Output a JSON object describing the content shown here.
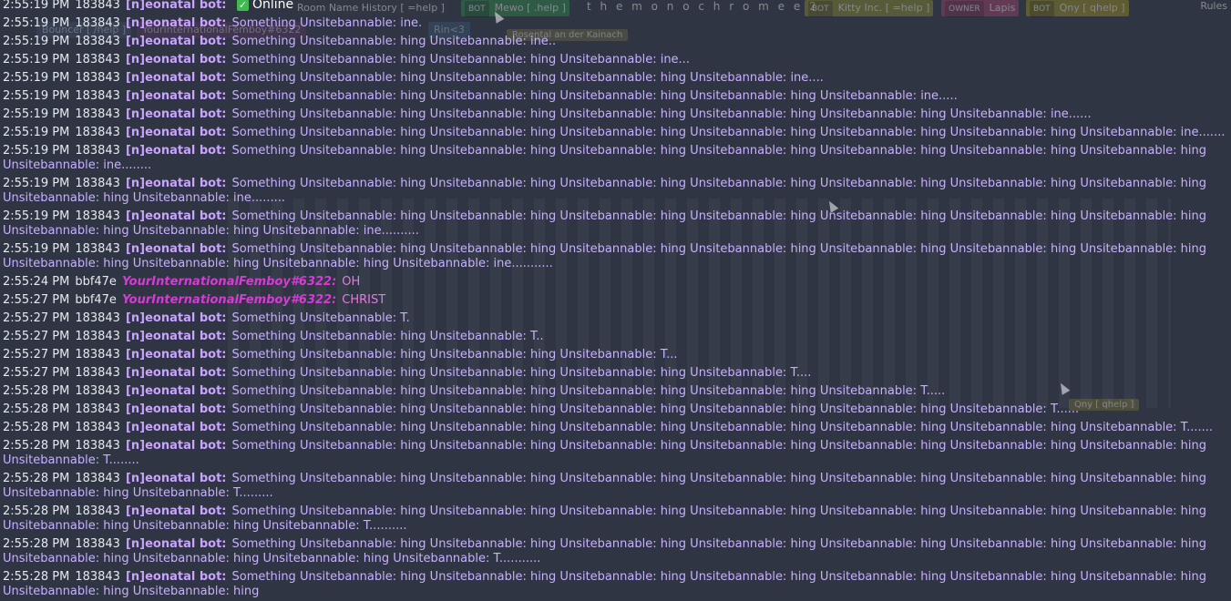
{
  "status": {
    "online_label": "Online"
  },
  "room": {
    "title": "t h e m o n o c h r o m e",
    "title_suffix": "e 2",
    "history_tag": "Room Name History [ =help ]",
    "rules": "Rules"
  },
  "top_badges": [
    {
      "role": "BOT",
      "name": "Kitty Inc. [ =help ]"
    },
    {
      "role": "OWNER",
      "name": "Lapis"
    },
    {
      "role": "BOT",
      "name": "Qny [ qhelp ]"
    },
    {
      "role": "BOT",
      "name": "Mewo [ .help ]"
    }
  ],
  "second_row_tags": [
    {
      "name": "Bouncer [ /help ]"
    },
    {
      "name": "YourInternationalFemboy#6322"
    },
    {
      "name": "Rin<3"
    },
    {
      "name": "Rosental an der Kainach"
    }
  ],
  "floating_tags": [
    {
      "name": "Qny [ qhelp ]"
    }
  ],
  "messages": [
    {
      "kind": "bot",
      "time": "2:55:19 PM",
      "uid": "183843",
      "author": "[n]eonatal bot:",
      "text": ""
    },
    {
      "kind": "bot",
      "time": "2:55:19 PM",
      "uid": "183843",
      "author": "[n]eonatal bot:",
      "text": "Something Unsitebannable: ine."
    },
    {
      "kind": "bot",
      "time": "2:55:19 PM",
      "uid": "183843",
      "author": "[n]eonatal bot:",
      "text": "Something Unsitebannable: hing Unsitebannable: ine.."
    },
    {
      "kind": "bot",
      "time": "2:55:19 PM",
      "uid": "183843",
      "author": "[n]eonatal bot:",
      "text": "Something Unsitebannable: hing Unsitebannable: hing Unsitebannable: ine..."
    },
    {
      "kind": "bot",
      "time": "2:55:19 PM",
      "uid": "183843",
      "author": "[n]eonatal bot:",
      "text": "Something Unsitebannable: hing Unsitebannable: hing Unsitebannable: hing Unsitebannable: ine...."
    },
    {
      "kind": "bot",
      "time": "2:55:19 PM",
      "uid": "183843",
      "author": "[n]eonatal bot:",
      "text": "Something Unsitebannable: hing Unsitebannable: hing Unsitebannable: hing Unsitebannable: hing Unsitebannable: ine....."
    },
    {
      "kind": "bot",
      "time": "2:55:19 PM",
      "uid": "183843",
      "author": "[n]eonatal bot:",
      "text": "Something Unsitebannable: hing Unsitebannable: hing Unsitebannable: hing Unsitebannable: hing Unsitebannable: hing Unsitebannable: ine......"
    },
    {
      "kind": "bot",
      "time": "2:55:19 PM",
      "uid": "183843",
      "author": "[n]eonatal bot:",
      "text": "Something Unsitebannable: hing Unsitebannable: hing Unsitebannable: hing Unsitebannable: hing Unsitebannable: hing Unsitebannable: hing Unsitebannable: ine......."
    },
    {
      "kind": "bot",
      "time": "2:55:19 PM",
      "uid": "183843",
      "author": "[n]eonatal bot:",
      "text": "Something Unsitebannable: hing Unsitebannable: hing Unsitebannable: hing Unsitebannable: hing Unsitebannable: hing Unsitebannable: hing Unsitebannable: hing Unsitebannable: ine........"
    },
    {
      "kind": "bot",
      "time": "2:55:19 PM",
      "uid": "183843",
      "author": "[n]eonatal bot:",
      "text": "Something Unsitebannable: hing Unsitebannable: hing Unsitebannable: hing Unsitebannable: hing Unsitebannable: hing Unsitebannable: hing Unsitebannable: hing Unsitebannable: hing Unsitebannable: ine........."
    },
    {
      "kind": "bot",
      "time": "2:55:19 PM",
      "uid": "183843",
      "author": "[n]eonatal bot:",
      "text": "Something Unsitebannable: hing Unsitebannable: hing Unsitebannable: hing Unsitebannable: hing Unsitebannable: hing Unsitebannable: hing Unsitebannable: hing Unsitebannable: hing Unsitebannable: hing Unsitebannable: ine.........."
    },
    {
      "kind": "bot",
      "time": "2:55:19 PM",
      "uid": "183843",
      "author": "[n]eonatal bot:",
      "text": "Something Unsitebannable: hing Unsitebannable: hing Unsitebannable: hing Unsitebannable: hing Unsitebannable: hing Unsitebannable: hing Unsitebannable: hing Unsitebannable: hing Unsitebannable: hing Unsitebannable: hing Unsitebannable: ine..........."
    },
    {
      "kind": "user",
      "time": "2:55:24 PM",
      "uid": "bbf47e",
      "author": "YourInternationalFemboy#6322:",
      "text": "OH"
    },
    {
      "kind": "user",
      "time": "2:55:27 PM",
      "uid": "bbf47e",
      "author": "YourInternationalFemboy#6322:",
      "text": "CHRIST"
    },
    {
      "kind": "bot",
      "time": "2:55:27 PM",
      "uid": "183843",
      "author": "[n]eonatal bot:",
      "text": "Something Unsitebannable: T."
    },
    {
      "kind": "bot",
      "time": "2:55:27 PM",
      "uid": "183843",
      "author": "[n]eonatal bot:",
      "text": "Something Unsitebannable: hing Unsitebannable: T.."
    },
    {
      "kind": "bot",
      "time": "2:55:27 PM",
      "uid": "183843",
      "author": "[n]eonatal bot:",
      "text": "Something Unsitebannable: hing Unsitebannable: hing Unsitebannable: T..."
    },
    {
      "kind": "bot",
      "time": "2:55:27 PM",
      "uid": "183843",
      "author": "[n]eonatal bot:",
      "text": "Something Unsitebannable: hing Unsitebannable: hing Unsitebannable: hing Unsitebannable: T...."
    },
    {
      "kind": "bot",
      "time": "2:55:28 PM",
      "uid": "183843",
      "author": "[n]eonatal bot:",
      "text": "Something Unsitebannable: hing Unsitebannable: hing Unsitebannable: hing Unsitebannable: hing Unsitebannable: T....."
    },
    {
      "kind": "bot",
      "time": "2:55:28 PM",
      "uid": "183843",
      "author": "[n]eonatal bot:",
      "text": "Something Unsitebannable: hing Unsitebannable: hing Unsitebannable: hing Unsitebannable: hing Unsitebannable: hing Unsitebannable: T......"
    },
    {
      "kind": "bot",
      "time": "2:55:28 PM",
      "uid": "183843",
      "author": "[n]eonatal bot:",
      "text": "Something Unsitebannable: hing Unsitebannable: hing Unsitebannable: hing Unsitebannable: hing Unsitebannable: hing Unsitebannable: hing Unsitebannable: T......."
    },
    {
      "kind": "bot",
      "time": "2:55:28 PM",
      "uid": "183843",
      "author": "[n]eonatal bot:",
      "text": "Something Unsitebannable: hing Unsitebannable: hing Unsitebannable: hing Unsitebannable: hing Unsitebannable: hing Unsitebannable: hing Unsitebannable: hing Unsitebannable: T........"
    },
    {
      "kind": "bot",
      "time": "2:55:28 PM",
      "uid": "183843",
      "author": "[n]eonatal bot:",
      "text": "Something Unsitebannable: hing Unsitebannable: hing Unsitebannable: hing Unsitebannable: hing Unsitebannable: hing Unsitebannable: hing Unsitebannable: hing Unsitebannable: hing Unsitebannable: T........."
    },
    {
      "kind": "bot",
      "time": "2:55:28 PM",
      "uid": "183843",
      "author": "[n]eonatal bot:",
      "text": "Something Unsitebannable: hing Unsitebannable: hing Unsitebannable: hing Unsitebannable: hing Unsitebannable: hing Unsitebannable: hing Unsitebannable: hing Unsitebannable: hing Unsitebannable: hing Unsitebannable: T.........."
    },
    {
      "kind": "bot",
      "time": "2:55:28 PM",
      "uid": "183843",
      "author": "[n]eonatal bot:",
      "text": "Something Unsitebannable: hing Unsitebannable: hing Unsitebannable: hing Unsitebannable: hing Unsitebannable: hing Unsitebannable: hing Unsitebannable: hing Unsitebannable: hing Unsitebannable: hing Unsitebannable: hing Unsitebannable: T..........."
    },
    {
      "kind": "bot",
      "time": "2:55:28 PM",
      "uid": "183843",
      "author": "[n]eonatal bot:",
      "text": "Something Unsitebannable: hing Unsitebannable: hing Unsitebannable: hing Unsitebannable: hing Unsitebannable: hing Unsitebannable: hing Unsitebannable: hing Unsitebannable: hing Unsitebannable: hing"
    }
  ]
}
